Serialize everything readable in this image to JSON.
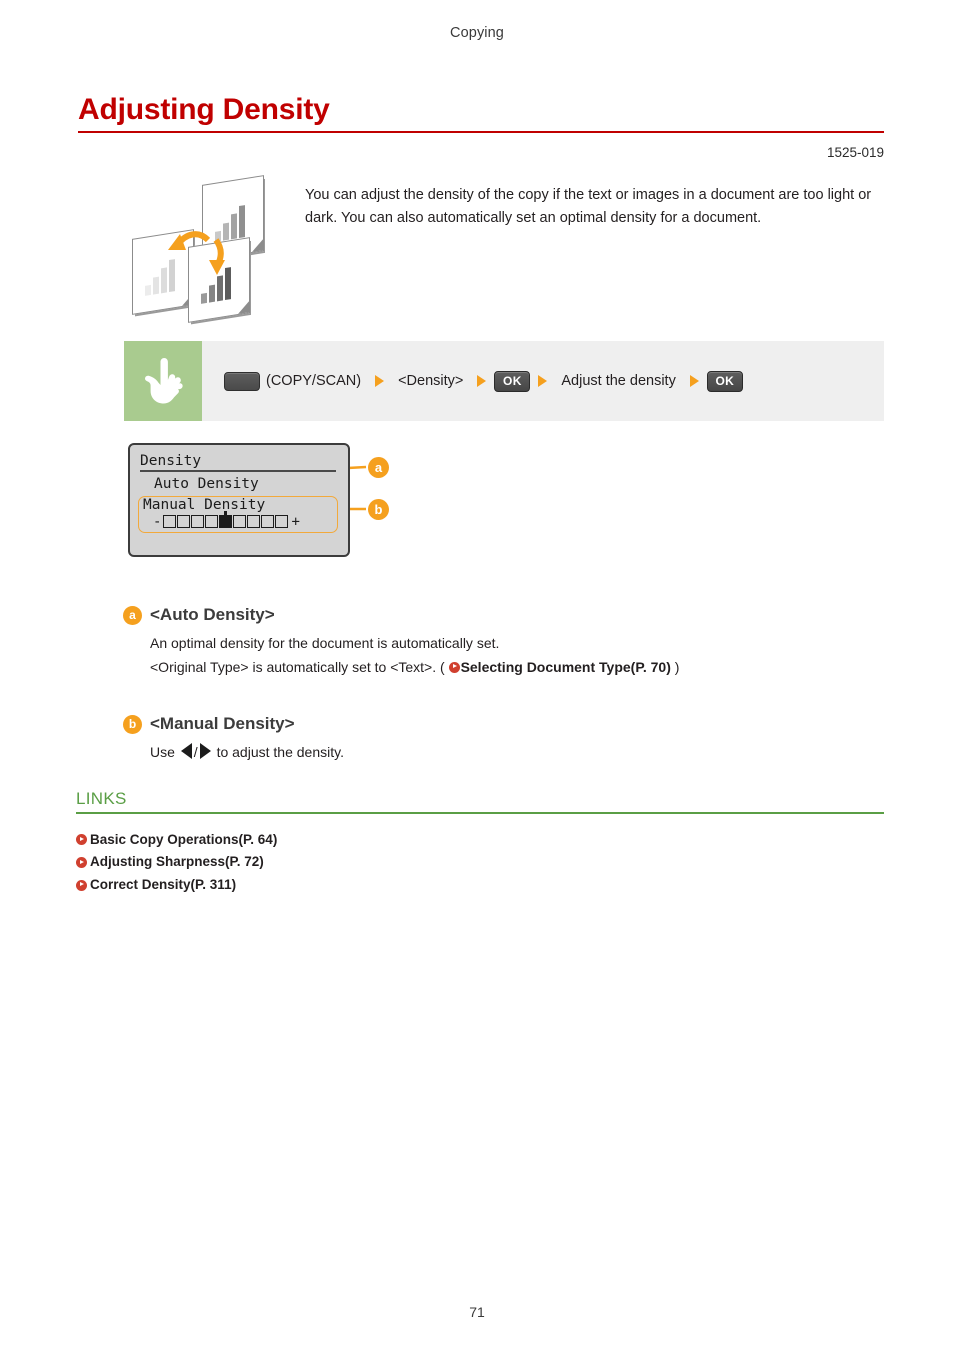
{
  "header": {
    "running_title": "Copying"
  },
  "title": {
    "text": "Adjusting Density",
    "doc_code": "1525-019",
    "color": "#c00000"
  },
  "intro": {
    "text": "You can adjust the density of the copy if the text or images in a document are too light or dark. You can also automatically set an optimal density for a document."
  },
  "procedure": {
    "hand_icon": "pointing-hand-icon",
    "key_icon": "blank-key-icon",
    "key_caption": "(COPY/SCAN)",
    "step_density": "<Density>",
    "ok_1": "OK",
    "step_adjust": "Adjust the density",
    "ok_2": "OK",
    "arrow_color": "#f5a01e",
    "panel_color": "#a9cb8f"
  },
  "lcd": {
    "title": "Density",
    "item_auto": "Auto Density",
    "item_manual": "Manual Density",
    "slider": {
      "minus": "-",
      "plus": "+",
      "cells": 9,
      "filled_index": 5
    },
    "callouts": [
      {
        "id": "a",
        "label": "a"
      },
      {
        "id": "b",
        "label": "b"
      }
    ]
  },
  "descriptions": [
    {
      "badge": "a",
      "heading": "<Auto Density>",
      "line1": "An optimal density for the document is automatically set.",
      "line2_prefix": "<Original Type> is automatically set to <Text>. ( ",
      "line2_link": "Selecting Document Type(P. 70)",
      "line2_suffix": " )"
    },
    {
      "badge": "b",
      "heading": "<Manual Density>",
      "use_prefix": "Use",
      "separator": "/",
      "use_suffix": "to adjust the density.",
      "icon_left": "triangle-left-icon",
      "icon_right": "triangle-right-icon"
    }
  ],
  "links": {
    "heading": "LINKS",
    "color": "#5a9e45",
    "items": [
      {
        "label": "Basic Copy Operations(P. 64)"
      },
      {
        "label": "Adjusting Sharpness(P. 72)"
      },
      {
        "label": "Correct Density(P. 311)"
      }
    ]
  },
  "footer": {
    "page_number": "71"
  }
}
